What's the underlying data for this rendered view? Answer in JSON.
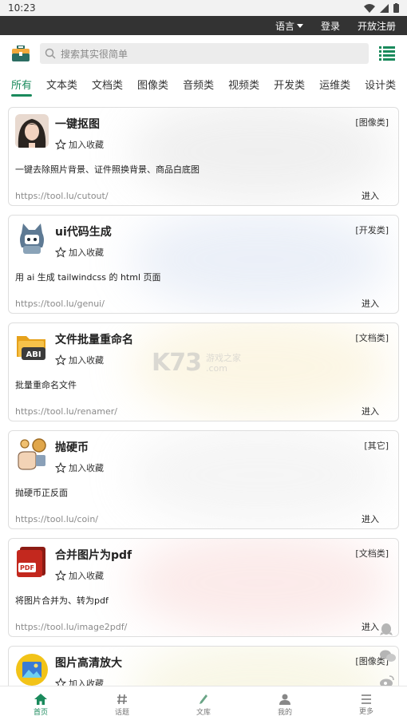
{
  "status_bar": {
    "time": "10:23"
  },
  "topbar": {
    "language": "语言",
    "login": "登录",
    "register": "开放注册"
  },
  "search": {
    "placeholder": "搜索其实很简单"
  },
  "tabs": [
    "所有",
    "文本类",
    "文档类",
    "图像类",
    "音频类",
    "视频类",
    "开发类",
    "运维类",
    "设计类"
  ],
  "active_tab": "所有",
  "favorite_label": "加入收藏",
  "enter_label": "进入",
  "cards": [
    {
      "title": "一键抠图",
      "category": "[图像类]",
      "desc": "一键去除照片背景、证件照换背景、商品白底图",
      "url": "https://tool.lu/cutout/",
      "icon": "portrait-photo-icon",
      "glow": "#c9c9c9"
    },
    {
      "title": "ui代码生成",
      "category": "[开发类]",
      "desc": "用 ai 生成 tailwindcss 的 html 页面",
      "url": "https://tool.lu/genui/",
      "icon": "robot-cat-icon",
      "glow": "#b9c9e6"
    },
    {
      "title": "文件批量重命名",
      "category": "[文档类]",
      "desc": "批量重命名文件",
      "url": "https://tool.lu/renamer/",
      "icon": "folder-abi-icon",
      "glow": "#f3dfa0"
    },
    {
      "title": "抛硬币",
      "category": "[其它]",
      "desc": "抛硬币正反面",
      "url": "https://tool.lu/coin/",
      "icon": "coin-toss-icon",
      "glow": "#dcdcdc"
    },
    {
      "title": "合并图片为pdf",
      "category": "[文档类]",
      "desc": "将图片合并为、转为pdf",
      "url": "https://tool.lu/image2pdf/",
      "icon": "pdf-file-icon",
      "glow": "#f2b7b4"
    },
    {
      "title": "图片高清放大",
      "category": "[图像类]",
      "desc": "",
      "url": "",
      "icon": "image-upscale-icon",
      "glow": "#e8e2a8"
    }
  ],
  "watermark": {
    "big": "K73",
    "line1": "游戏之家",
    "line2": ".com"
  },
  "bottom_nav": [
    {
      "label": "首页",
      "icon": "home-icon"
    },
    {
      "label": "话题",
      "icon": "hash-icon"
    },
    {
      "label": "文库",
      "icon": "library-icon"
    },
    {
      "label": "我的",
      "icon": "user-icon"
    },
    {
      "label": "更多",
      "icon": "more-icon"
    }
  ],
  "colors": {
    "accent": "#1a8a5c",
    "topbar": "#333333",
    "search_bg": "#ececec"
  }
}
